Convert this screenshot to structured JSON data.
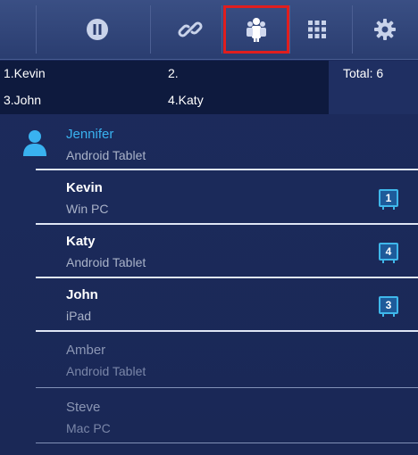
{
  "toolbar": {
    "buttons": [
      {
        "icon": "pause-icon"
      },
      {
        "icon": "link-icon"
      },
      {
        "icon": "participants-icon",
        "selected": true
      },
      {
        "icon": "grid-icon"
      },
      {
        "icon": "gear-icon"
      }
    ]
  },
  "summary": {
    "slot1": "1.Kevin",
    "slot2": "2.",
    "slot3": "3.John",
    "slot4": "4.Katy",
    "total": "Total: 6"
  },
  "participants": [
    {
      "name": "Jennifer",
      "device": "Android Tablet",
      "is_self": true
    },
    {
      "name": "Kevin",
      "device": "Win PC",
      "position": "1"
    },
    {
      "name": "Katy",
      "device": "Android Tablet",
      "position": "4"
    },
    {
      "name": "John",
      "device": "iPad",
      "position": "3"
    },
    {
      "name": "Amber",
      "device": "Android Tablet"
    },
    {
      "name": "Steve",
      "device": "Mac PC"
    }
  ],
  "colors": {
    "background": "#1b2a5a",
    "accent": "#39b2f0",
    "selection": "#e01e1e"
  }
}
